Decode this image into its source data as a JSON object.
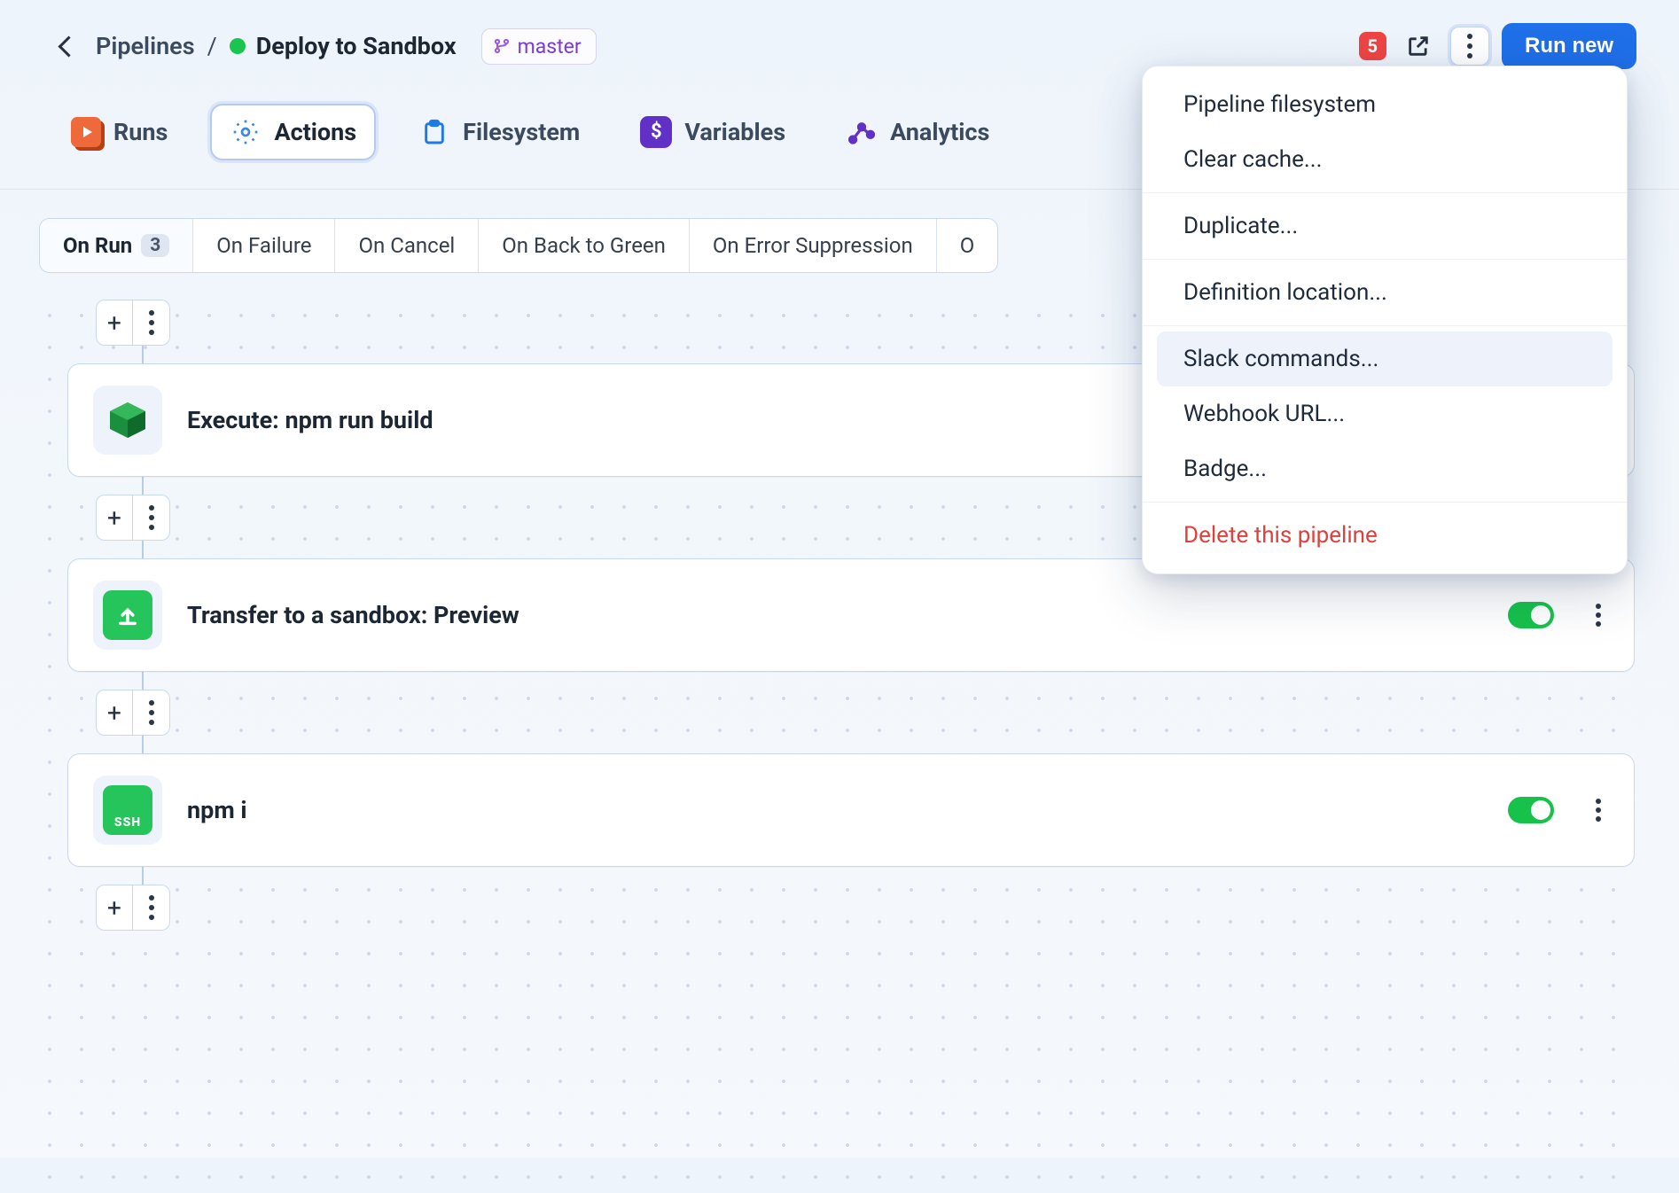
{
  "breadcrumb": {
    "parent": "Pipelines",
    "current": "Deploy to Sandbox"
  },
  "branch": "master",
  "notifications": "5",
  "run_button": "Run new",
  "tabs": {
    "runs": "Runs",
    "actions": "Actions",
    "filesystem": "Filesystem",
    "variables": "Variables",
    "analytics": "Analytics"
  },
  "subtabs": {
    "on_run": "On Run",
    "on_run_count": "3",
    "on_failure": "On Failure",
    "on_cancel": "On Cancel",
    "on_back_to_green": "On Back to Green",
    "on_error_suppression": "On Error Suppression",
    "truncated": "O"
  },
  "actions": [
    {
      "title": "Execute: npm run build"
    },
    {
      "title": "Transfer to a sandbox: Preview"
    },
    {
      "title": "npm i"
    }
  ],
  "menu": {
    "pipeline_filesystem": "Pipeline filesystem",
    "clear_cache": "Clear cache...",
    "duplicate": "Duplicate...",
    "definition_location": "Definition location...",
    "slack_commands": "Slack commands...",
    "webhook_url": "Webhook URL...",
    "badge": "Badge...",
    "delete": "Delete this pipeline"
  }
}
